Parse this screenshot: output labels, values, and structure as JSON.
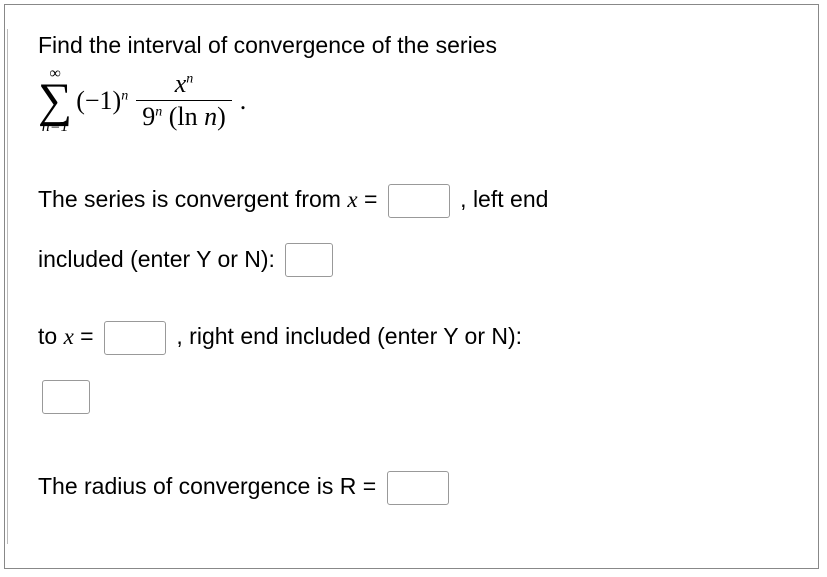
{
  "prompt": "Find the interval of convergence of the series",
  "series": {
    "upper": "∞",
    "lower": "n=1",
    "coef_base": "(−1)",
    "coef_exp": "n",
    "frac_num_base": "x",
    "frac_num_exp": "n",
    "frac_den_base": "9",
    "frac_den_exp": "n",
    "frac_den_rest": " (ln ",
    "frac_den_var": "n",
    "frac_den_close": ")",
    "trailing": "."
  },
  "line1a": "The series is convergent from ",
  "line1var": "x",
  "line1b": " = ",
  "line1c": " , left end",
  "line2": "included (enter Y or N): ",
  "line3a": "to ",
  "line3var": "x",
  "line3b": " = ",
  "line3c": " , right end included (enter Y or N):",
  "line4a": "The radius of convergence is R = "
}
